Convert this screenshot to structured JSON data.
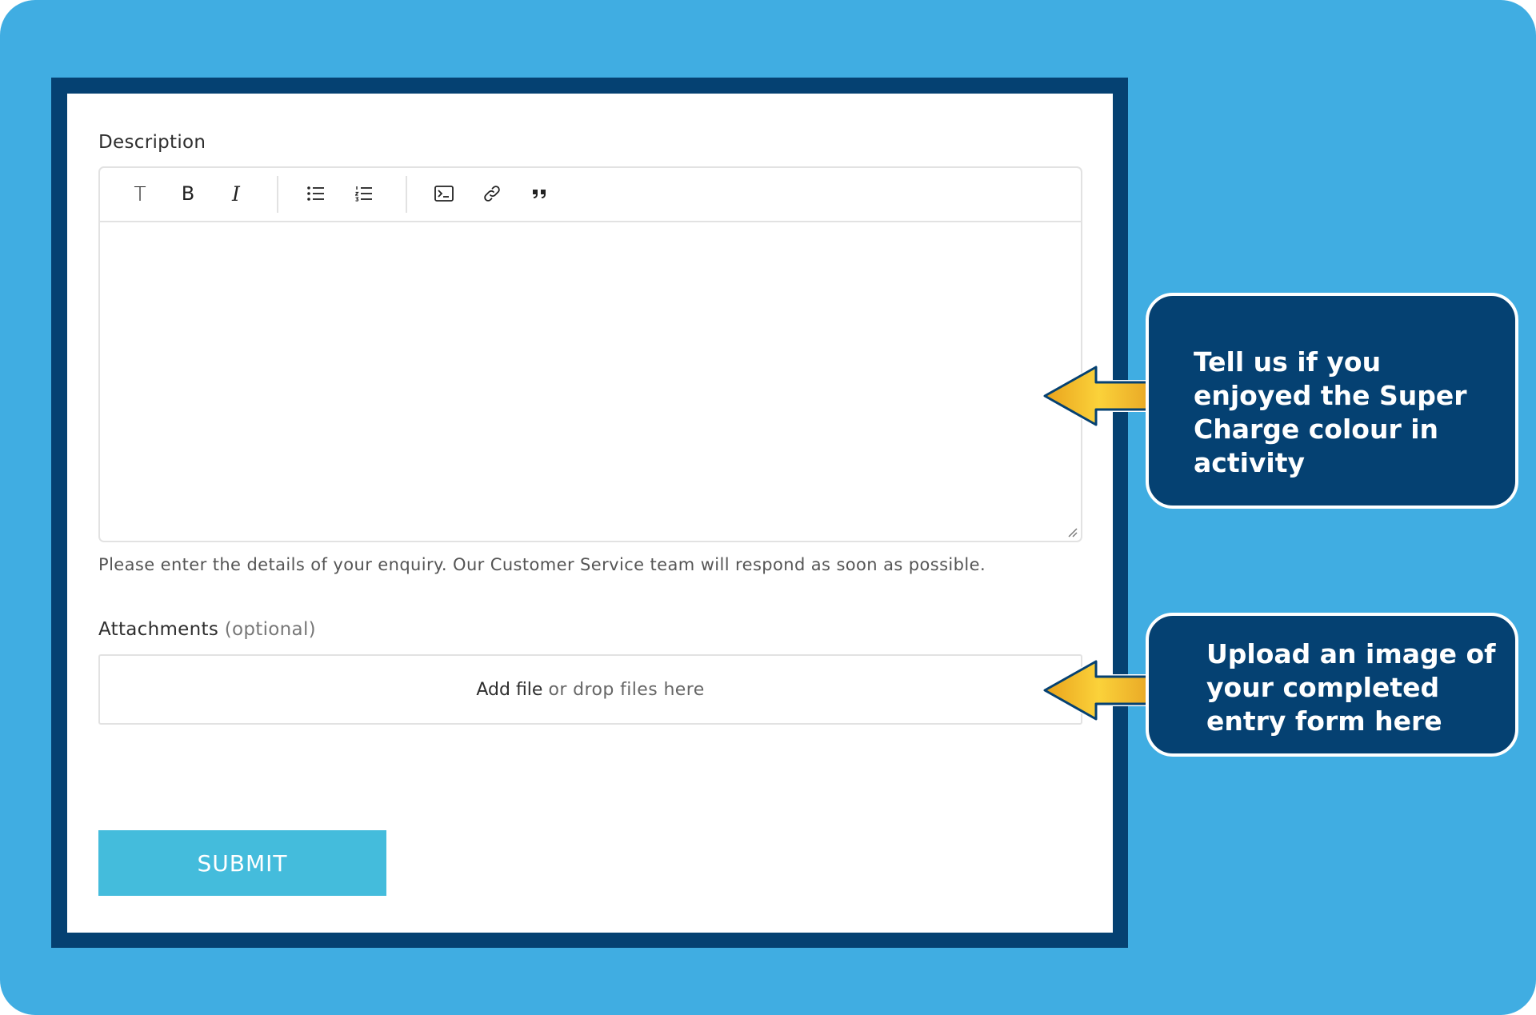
{
  "form": {
    "description_label": "Description",
    "description_help": "Please enter the details of your enquiry. Our Customer Service team will respond as soon as possible.",
    "attachments_label": "Attachments",
    "attachments_optional": "(optional)",
    "dropzone_add": "Add file",
    "dropzone_or": "or drop files here",
    "submit_label": "SUBMIT"
  },
  "toolbar": {
    "buttons": [
      "text-icon",
      "bold-icon",
      "italic-icon",
      "bullet-list-icon",
      "numbered-list-icon",
      "code-icon",
      "link-icon",
      "quote-icon"
    ],
    "text_glyph": "T",
    "bold_glyph": "B",
    "italic_glyph": "I"
  },
  "callouts": {
    "description_note": "Tell us if you enjoyed the Super Charge colour in activity",
    "upload_note": "Upload an image of your completed entry form here"
  },
  "colors": {
    "background": "#40ade2",
    "frame": "#054172",
    "submit": "#44bcdc",
    "arrow": "#f2b52b"
  }
}
